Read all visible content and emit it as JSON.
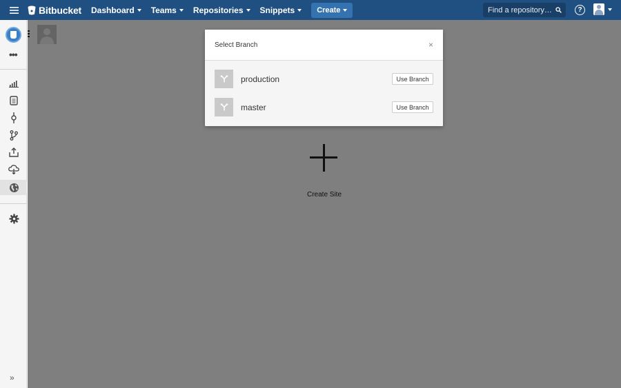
{
  "topnav": {
    "brand": "Bitbucket",
    "menu": [
      {
        "label": "Dashboard"
      },
      {
        "label": "Teams"
      },
      {
        "label": "Repositories"
      },
      {
        "label": "Snippets"
      }
    ],
    "create_label": "Create",
    "search_placeholder": "Find a repository…",
    "help_glyph": "?",
    "bar_color": "#205081",
    "create_color": "#3572b0"
  },
  "sidebar": {
    "more_glyph": "•••",
    "expand_glyph": "»",
    "icons": [
      "overview-icon",
      "source-icon",
      "commits-icon",
      "branches-icon",
      "downloads-icon",
      "deployments-icon",
      "sites-icon",
      "settings-icon"
    ],
    "active_icon": "sites-icon"
  },
  "main": {
    "create_site_label": "Create Site"
  },
  "dialog": {
    "title": "Select Branch",
    "close_glyph": "×",
    "branches": [
      {
        "name": "production",
        "button": "Use Branch"
      },
      {
        "name": "master",
        "button": "Use Branch"
      }
    ]
  }
}
